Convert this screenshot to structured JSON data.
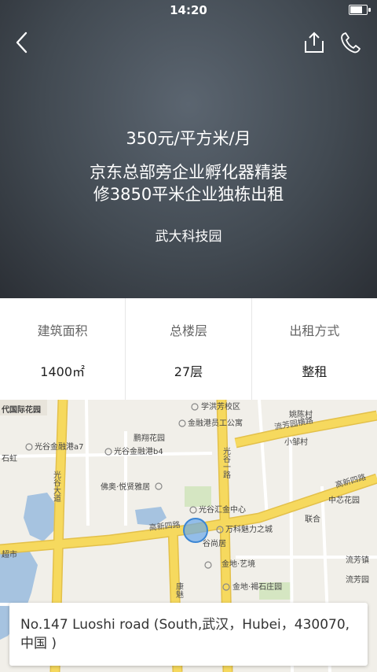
{
  "status_bar": {
    "time": "14:20",
    "battery_level": 0.85
  },
  "header": {
    "price": "350元/平方米/月",
    "title_line1": "京东总部旁企业孵化器精装",
    "title_line2": "修3850平米企业独栋出租",
    "park": "武大科技园",
    "icons": [
      "back-icon",
      "share-icon",
      "phone-icon"
    ]
  },
  "stats": [
    {
      "label": "建筑面积",
      "value": "1400㎡"
    },
    {
      "label": "总楼层",
      "value": "27层"
    },
    {
      "label": "出租方式",
      "value": "整租"
    }
  ],
  "map": {
    "labels": {
      "l1": "学洪芳校区",
      "l2": "代国际花园",
      "l3": "光谷金融港a7",
      "l4": "光谷金融港b4",
      "l5": "金融港员工公寓",
      "l6": "鹏翔花园",
      "l7": "佛奥·悦贤雅居",
      "l8": "光谷汇金中心",
      "l9": "万科魅力之城",
      "l10": "谷尚居",
      "l11": "金地·艺境",
      "l12": "金地·褐石庄园",
      "l13": "姚陈村",
      "l14": "小邹村",
      "l15": "中芯花园",
      "l16": "联合",
      "l17": "流芳镇",
      "l18": "流芳园",
      "l19": "石虹",
      "l20": "超市",
      "r1": "流芳园横路",
      "r2": "光谷一路",
      "r3": "光谷大道",
      "r4": "高新四路",
      "r5": "高新四路",
      "r6": "康魅"
    },
    "colors": {
      "road": "#f6d95e",
      "road_edge": "#e3c04a",
      "water": "#a6c3e0",
      "green": "#d5e6c2",
      "base": "#f1efe9"
    }
  },
  "address": "No.147 Luoshi road (South,武汉，Hubei，430070,中国 )"
}
